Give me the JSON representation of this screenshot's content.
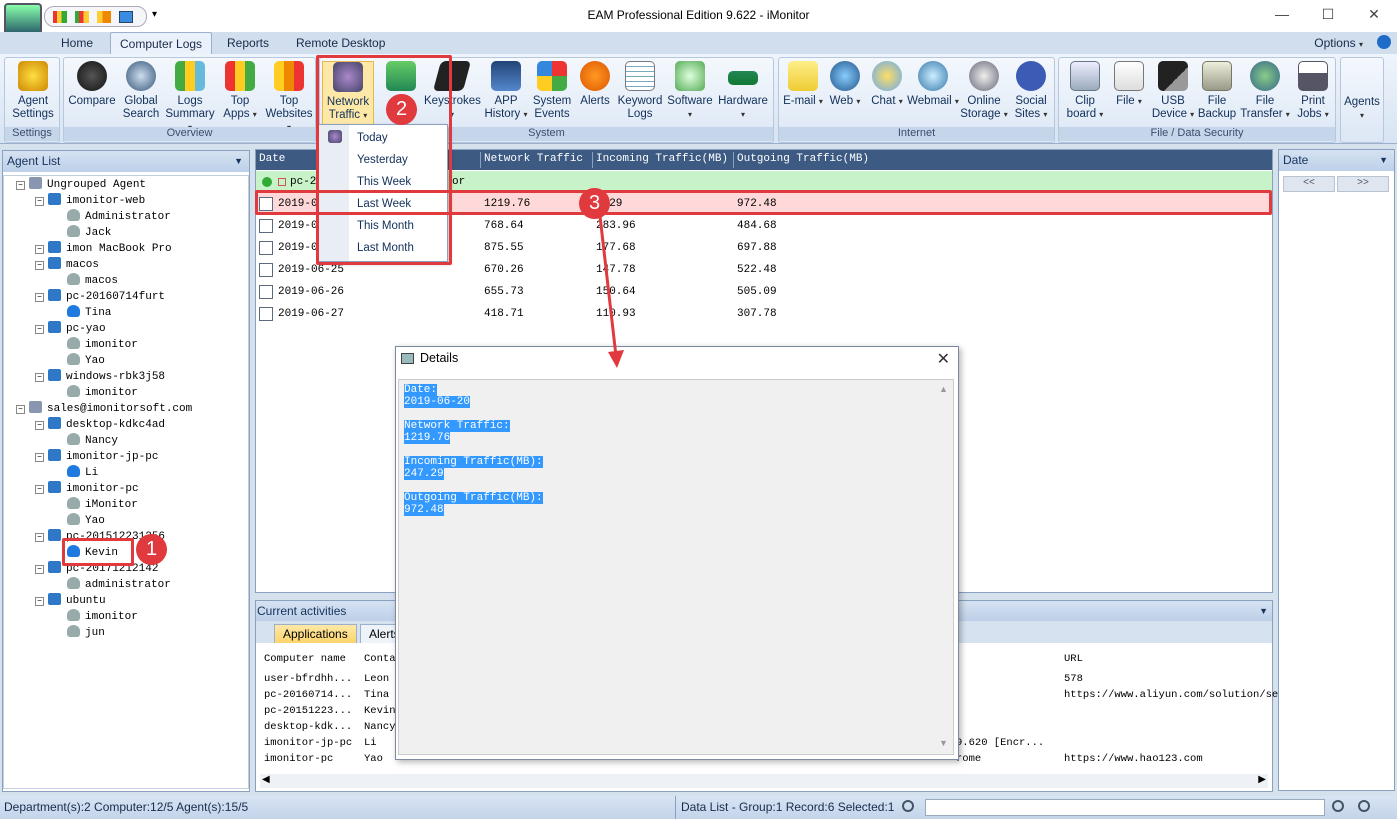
{
  "window": {
    "title": "EAM Professional Edition 9.622 - iMonitor"
  },
  "tabs": {
    "home": "Home",
    "computer_logs": "Computer Logs",
    "reports": "Reports",
    "remote_desktop": "Remote Desktop",
    "options": "Options"
  },
  "ribbon": {
    "agent_settings": "Agent Settings",
    "compare": "Compare",
    "global_search": "Global Search",
    "logs_summary": "Logs Summary",
    "top_apps": "Top Apps",
    "top_websites": "Top Websites",
    "network_traffic": "Network Traffic",
    "screenshots": "",
    "keystrokes": "Keystrokes",
    "app_history": "APP History",
    "system_events": "System Events",
    "alerts": "Alerts",
    "keyword_logs": "Keyword Logs",
    "software": "Software",
    "hardware": "Hardware",
    "email": "E-mail",
    "web": "Web",
    "chat": "Chat",
    "webmail": "Webmail",
    "online_storage": "Online Storage",
    "social_sites": "Social Sites",
    "clipboard": "Clip board",
    "file": "File",
    "usb_device": "USB Device",
    "file_backup": "File Backup",
    "file_transfer": "File Transfer",
    "print_jobs": "Print Jobs",
    "agents": "Agents",
    "groups": {
      "settings": "Settings",
      "overview": "Overview",
      "system": "System",
      "internet": "Internet",
      "file_data_security": "File / Data Security"
    }
  },
  "traffic_menu": [
    "Today",
    "Yesterday",
    "This Week",
    "Last Week",
    "This Month",
    "Last Month"
  ],
  "agent_list": {
    "title": "Agent List",
    "items": [
      {
        "text": "Ungrouped Agent",
        "level": 0,
        "type": "group"
      },
      {
        "text": "imonitor-web",
        "level": 1,
        "type": "pc"
      },
      {
        "text": "Administrator",
        "level": 2,
        "type": "user"
      },
      {
        "text": "Jack",
        "level": 2,
        "type": "user"
      },
      {
        "text": "imon       MacBook Pro",
        "level": 1,
        "type": "pc"
      },
      {
        "text": "macos",
        "level": 1,
        "type": "pc"
      },
      {
        "text": "macos",
        "level": 2,
        "type": "user"
      },
      {
        "text": "pc-20160714furt",
        "level": 1,
        "type": "pc"
      },
      {
        "text": "Tina",
        "level": 2,
        "type": "userb"
      },
      {
        "text": "pc-yao",
        "level": 1,
        "type": "pc"
      },
      {
        "text": "imonitor",
        "level": 2,
        "type": "user"
      },
      {
        "text": "Yao",
        "level": 2,
        "type": "user"
      },
      {
        "text": "windows-rbk3j58",
        "level": 1,
        "type": "pc"
      },
      {
        "text": "imonitor",
        "level": 2,
        "type": "user"
      },
      {
        "text": "sales@imonitorsoft.com",
        "level": 0,
        "type": "group"
      },
      {
        "text": "desktop-kdkc4ad",
        "level": 1,
        "type": "pc"
      },
      {
        "text": "Nancy",
        "level": 2,
        "type": "user"
      },
      {
        "text": "imonitor-jp-pc",
        "level": 1,
        "type": "pc"
      },
      {
        "text": "Li",
        "level": 2,
        "type": "userb"
      },
      {
        "text": "imonitor-pc",
        "level": 1,
        "type": "pc"
      },
      {
        "text": "iMonitor",
        "level": 2,
        "type": "user"
      },
      {
        "text": "Yao",
        "level": 2,
        "type": "user"
      },
      {
        "text": "pc-201512231256",
        "level": 1,
        "type": "pc"
      },
      {
        "text": "Kevin",
        "level": 2,
        "type": "userb"
      },
      {
        "text": "pc-20171212142",
        "level": 1,
        "type": "pc"
      },
      {
        "text": "administrator",
        "level": 2,
        "type": "user"
      },
      {
        "text": "ubuntu",
        "level": 1,
        "type": "pc"
      },
      {
        "text": "imonitor",
        "level": 2,
        "type": "user"
      },
      {
        "text": "jun",
        "level": 2,
        "type": "user"
      }
    ]
  },
  "grid": {
    "columns": [
      "Date",
      "Network Traffic",
      "Incoming Traffic(MB)",
      "Outgoing Traffic(MB)"
    ],
    "group_label": "pc-20",
    "group_suffix": "or",
    "rows": [
      {
        "date": "2019-06-",
        "net": "1219.76",
        "inc": "7.29",
        "out": "972.48"
      },
      {
        "date": "2019-06-",
        "net": "768.64",
        "inc": "283.96",
        "out": "484.68"
      },
      {
        "date": "2019-06-",
        "net": "875.55",
        "inc": "177.68",
        "out": "697.88"
      },
      {
        "date": "2019-06-25",
        "net": "670.26",
        "inc": "147.78",
        "out": "522.48"
      },
      {
        "date": "2019-06-26",
        "net": "655.73",
        "inc": "150.64",
        "out": "505.09"
      },
      {
        "date": "2019-06-27",
        "net": "418.71",
        "inc": "110.93",
        "out": "307.78"
      }
    ]
  },
  "date_panel": {
    "title": "Date",
    "prev": "<<",
    "next": ">>"
  },
  "activities": {
    "title": "Current activities",
    "tabs": [
      "Applications",
      "Alerts"
    ],
    "columns": [
      "Computer name",
      "Conta",
      "URL"
    ],
    "rows": [
      {
        "computer": "user-bfrdhh...",
        "contact": "Leon",
        "mid": "",
        "url": "578"
      },
      {
        "computer": "pc-20160714...",
        "contact": "Tina",
        "mid": "",
        "url": "https://www.aliyun.com/solution/se"
      },
      {
        "computer": "pc-20151223...",
        "contact": "Kevin",
        "mid": "",
        "url": ""
      },
      {
        "computer": "desktop-kdk...",
        "contact": "Nancy",
        "mid": "",
        "url": ""
      },
      {
        "computer": "imonitor-jp-pc",
        "contact": "Li",
        "mid": "9.620 [Encr...",
        "url": ""
      },
      {
        "computer": "imonitor-pc",
        "contact": "Yao",
        "mid": "rome",
        "url": "https://www.hao123.com"
      }
    ]
  },
  "details": {
    "title": "Details",
    "date_label": "Date:",
    "date": "2019-06-20",
    "net_label": "Network Traffic:",
    "net": "1219.76",
    "inc_label": "Incoming Traffic(MB):",
    "inc": "247.29",
    "out_label": "Outgoing Traffic(MB):",
    "out": "972.48"
  },
  "status": {
    "left": "Department(s):2  Computer:12/5  Agent(s):15/5",
    "right": "Data List - Group:1  Record:6  Selected:1"
  },
  "callouts": {
    "one": "1",
    "two": "2",
    "three": "3"
  }
}
